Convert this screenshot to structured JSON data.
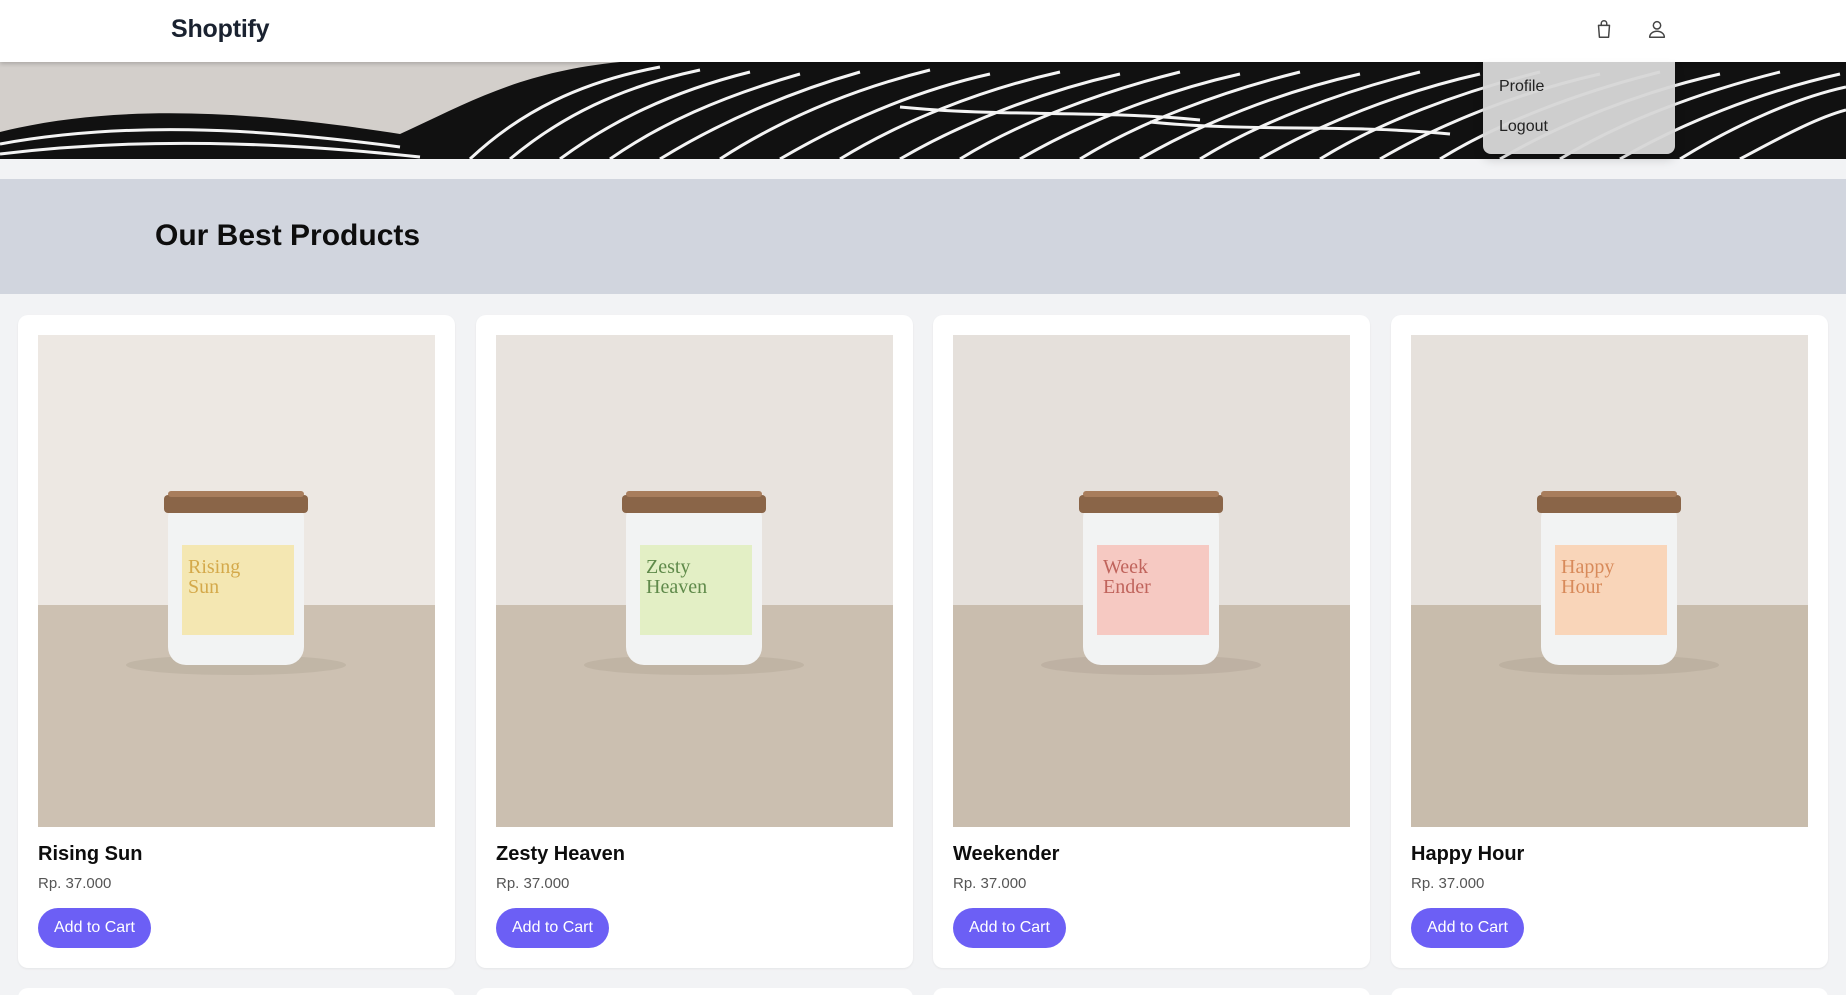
{
  "header": {
    "brand": "Shoptify",
    "cart_icon": "shopping-bag-icon",
    "user_icon": "user-icon"
  },
  "user_menu": {
    "items": [
      {
        "label": "Profile"
      },
      {
        "label": "Logout"
      }
    ]
  },
  "section": {
    "title": "Our Best Products"
  },
  "products": [
    {
      "name": "Rising Sun",
      "price": "Rp. 37.000",
      "button": "Add to Cart",
      "label_text": "Rising Sun",
      "label_color": "#f4e7b2",
      "label_ink": "#d4a94a"
    },
    {
      "name": "Zesty Heaven",
      "price": "Rp. 37.000",
      "button": "Add to Cart",
      "label_text": "Zesty Heaven",
      "label_color": "#e3efc5",
      "label_ink": "#5f8a4a"
    },
    {
      "name": "Weekender",
      "price": "Rp. 37.000",
      "button": "Add to Cart",
      "label_text": "Week Ender",
      "label_color": "#f6c9c2",
      "label_ink": "#c0645c"
    },
    {
      "name": "Happy Hour",
      "price": "Rp. 37.000",
      "button": "Add to Cart",
      "label_text": "Happy Hour",
      "label_color": "#f9d5b9",
      "label_ink": "#d88a5a"
    }
  ],
  "colors": {
    "accent": "#6c5ff5",
    "section_band": "#d1d5de",
    "page_bg": "#f2f3f5"
  }
}
